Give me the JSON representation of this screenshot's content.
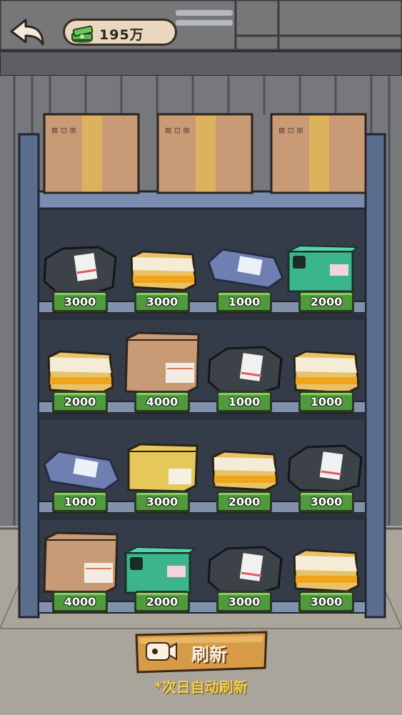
{
  "header": {
    "back_icon": "back-arrow-icon",
    "money_icon": "cash-stack-icon",
    "money_amount": "195万"
  },
  "shelf": {
    "top_boxes": [
      "cardboard-box",
      "cardboard-box",
      "cardboard-box"
    ],
    "rows": [
      [
        {
          "item": "black-bag",
          "price": "3000"
        },
        {
          "item": "yellow-parcel",
          "price": "3000"
        },
        {
          "item": "blue-bag",
          "price": "1000"
        },
        {
          "item": "green-box",
          "price": "2000"
        }
      ],
      [
        {
          "item": "yellow-parcel",
          "price": "2000"
        },
        {
          "item": "cardboard-box",
          "price": "4000"
        },
        {
          "item": "black-bag",
          "price": "1000"
        },
        {
          "item": "yellow-parcel",
          "price": "1000"
        }
      ],
      [
        {
          "item": "blue-bag",
          "price": "1000"
        },
        {
          "item": "yellow-box",
          "price": "3000"
        },
        {
          "item": "yellow-parcel",
          "price": "2000"
        },
        {
          "item": "black-bag",
          "price": "3000"
        }
      ],
      [
        {
          "item": "cardboard-box",
          "price": "4000"
        },
        {
          "item": "green-box",
          "price": "2000"
        },
        {
          "item": "black-bag",
          "price": "3000"
        },
        {
          "item": "yellow-parcel",
          "price": "3000"
        }
      ]
    ]
  },
  "footer": {
    "refresh_label": "刷新",
    "refresh_icon": "video-camera-icon",
    "refresh_note": "*次日自动刷新"
  },
  "colors": {
    "price_button": "#4f9a3d",
    "refresh_button": "#d79b47",
    "note_text": "#f6cf4a"
  }
}
